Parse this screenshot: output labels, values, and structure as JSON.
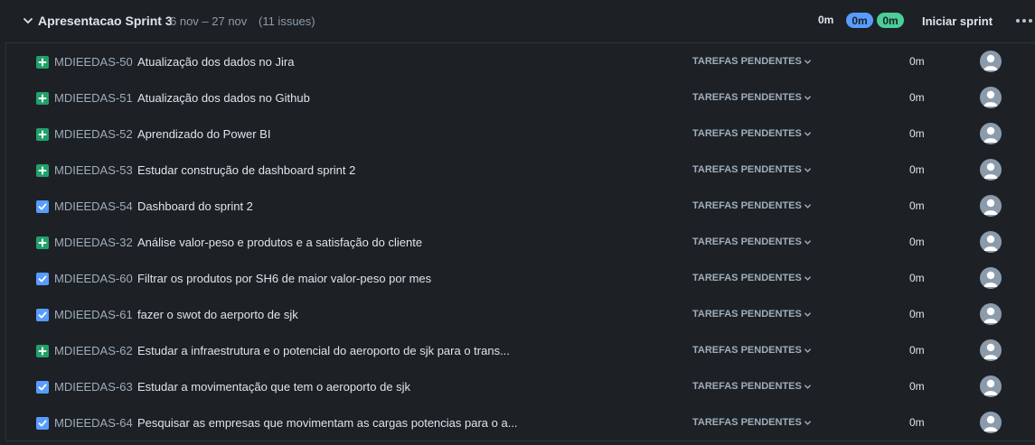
{
  "sprint": {
    "name": "Apresentacao Sprint 3",
    "dates": "6 nov – 27 nov",
    "issue_count": "(11 issues)",
    "estimate_todo": "0m",
    "estimate_in_progress": "0m",
    "estimate_done": "0m",
    "start_button_label": "Iniciar sprint",
    "more_label": "•••"
  },
  "colors": {
    "in_progress_pill": "#579dff",
    "done_pill": "#4bce97",
    "story_icon": "#22a06b",
    "task_icon": "#579dff"
  },
  "issues": [
    {
      "type": "story",
      "key": "MDIEEDAS-50",
      "summary": "Atualização dos dados no Jira",
      "status": "TAREFAS PENDENTES",
      "estimate": "0m"
    },
    {
      "type": "story",
      "key": "MDIEEDAS-51",
      "summary": "Atualização dos dados no Github",
      "status": "TAREFAS PENDENTES",
      "estimate": "0m"
    },
    {
      "type": "story",
      "key": "MDIEEDAS-52",
      "summary": "Aprendizado do Power BI",
      "status": "TAREFAS PENDENTES",
      "estimate": "0m"
    },
    {
      "type": "story",
      "key": "MDIEEDAS-53",
      "summary": "Estudar construção de dashboard sprint 2",
      "status": "TAREFAS PENDENTES",
      "estimate": "0m"
    },
    {
      "type": "task",
      "key": "MDIEEDAS-54",
      "summary": "Dashboard do sprint 2",
      "status": "TAREFAS PENDENTES",
      "estimate": "0m"
    },
    {
      "type": "story",
      "key": "MDIEEDAS-32",
      "summary": "Análise valor-peso e produtos e a satisfação do cliente",
      "status": "TAREFAS PENDENTES",
      "estimate": "0m"
    },
    {
      "type": "task",
      "key": "MDIEEDAS-60",
      "summary": "Filtrar os produtos por SH6 de maior valor-peso por mes",
      "status": "TAREFAS PENDENTES",
      "estimate": "0m"
    },
    {
      "type": "task",
      "key": "MDIEEDAS-61",
      "summary": "fazer o swot do aerporto de sjk",
      "status": "TAREFAS PENDENTES",
      "estimate": "0m"
    },
    {
      "type": "story",
      "key": "MDIEEDAS-62",
      "summary": "Estudar a infraestrutura e o potencial do aeroporto de sjk para o trans...",
      "status": "TAREFAS PENDENTES",
      "estimate": "0m"
    },
    {
      "type": "task",
      "key": "MDIEEDAS-63",
      "summary": "Estudar a movimentação que tem o aeroporto de sjk",
      "status": "TAREFAS PENDENTES",
      "estimate": "0m"
    },
    {
      "type": "task",
      "key": "MDIEEDAS-64",
      "summary": "Pesquisar as empresas que movimentam as cargas potencias para o a...",
      "status": "TAREFAS PENDENTES",
      "estimate": "0m"
    }
  ]
}
